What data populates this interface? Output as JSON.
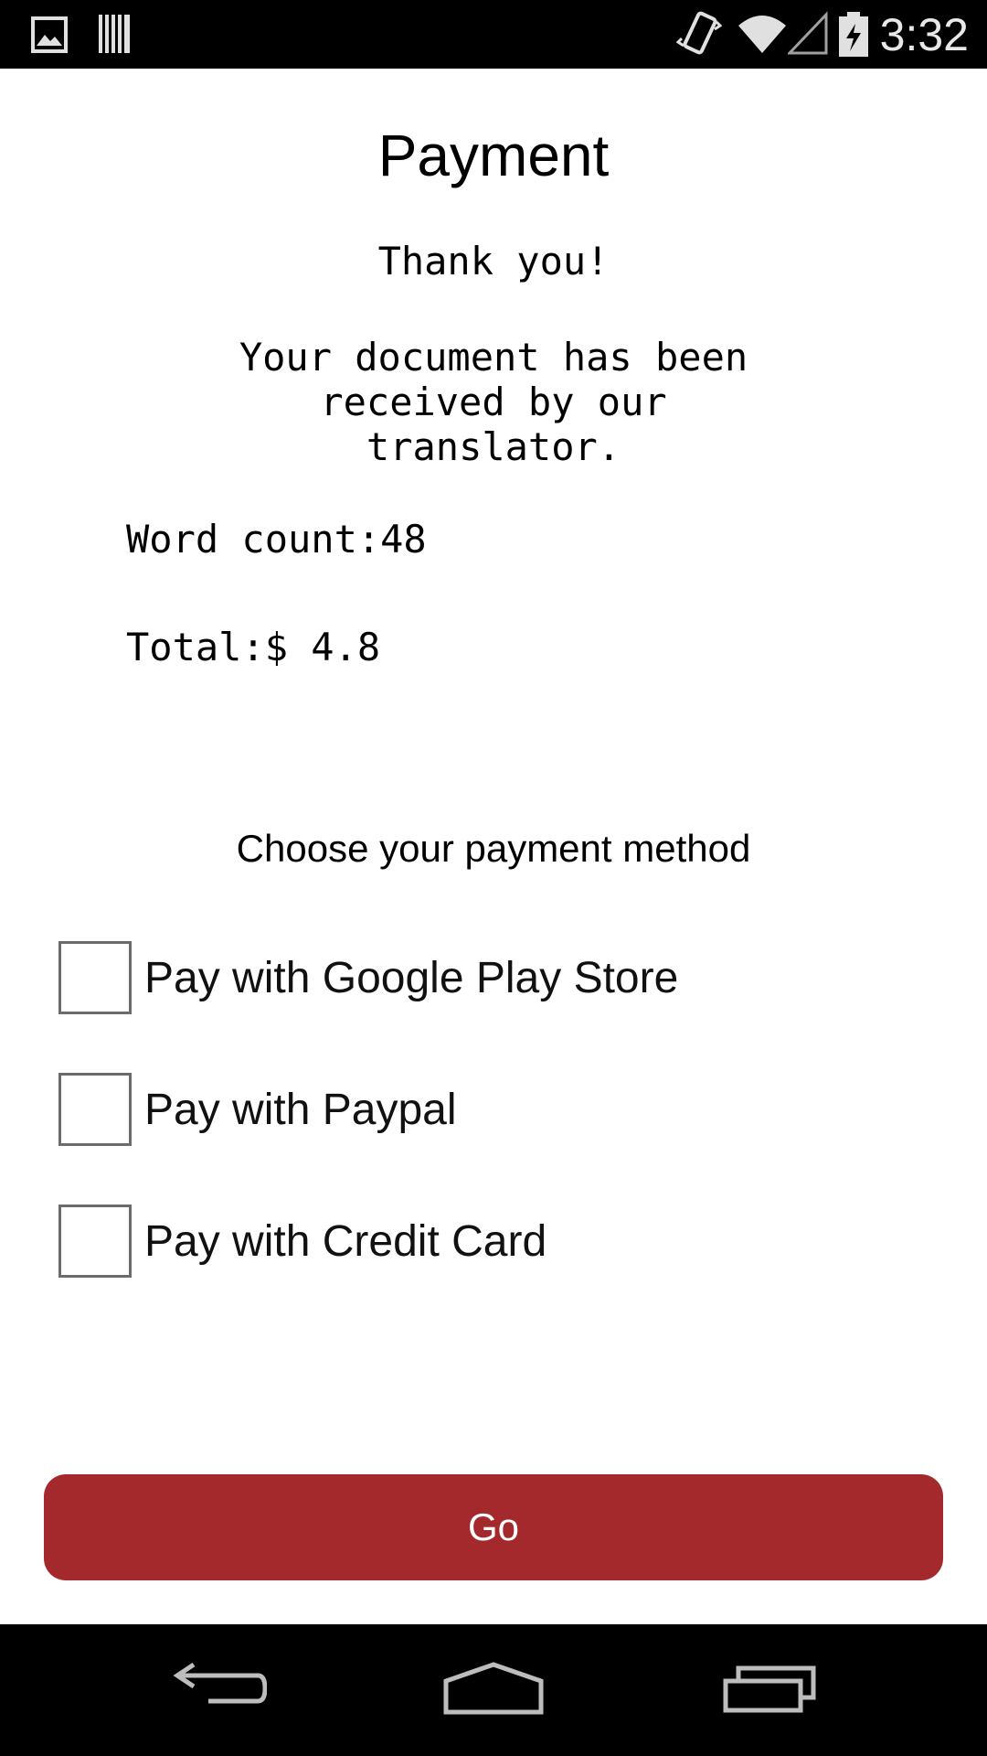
{
  "status_bar": {
    "time": "3:32",
    "icons": [
      "gallery-icon",
      "barcode-icon",
      "vibrate-icon",
      "wifi-icon",
      "signal-icon",
      "battery-charging-icon"
    ]
  },
  "page": {
    "title": "Payment",
    "thanks": "Thank you!",
    "message": "Your document has been received by our translator.",
    "word_count": "Word count:48",
    "total": "Total:$ 4.8"
  },
  "payment": {
    "prompt": "Choose your payment method",
    "options": [
      {
        "label": "Pay with Google Play Store",
        "checked": false
      },
      {
        "label": "Pay with Paypal",
        "checked": false
      },
      {
        "label": "Pay with Credit Card",
        "checked": false
      }
    ]
  },
  "actions": {
    "go_label": "Go"
  },
  "colors": {
    "accent": "#a4292c",
    "bars": "#000000"
  },
  "nav_bar": {
    "icons": [
      "back-icon",
      "home-icon",
      "recent-apps-icon"
    ]
  }
}
